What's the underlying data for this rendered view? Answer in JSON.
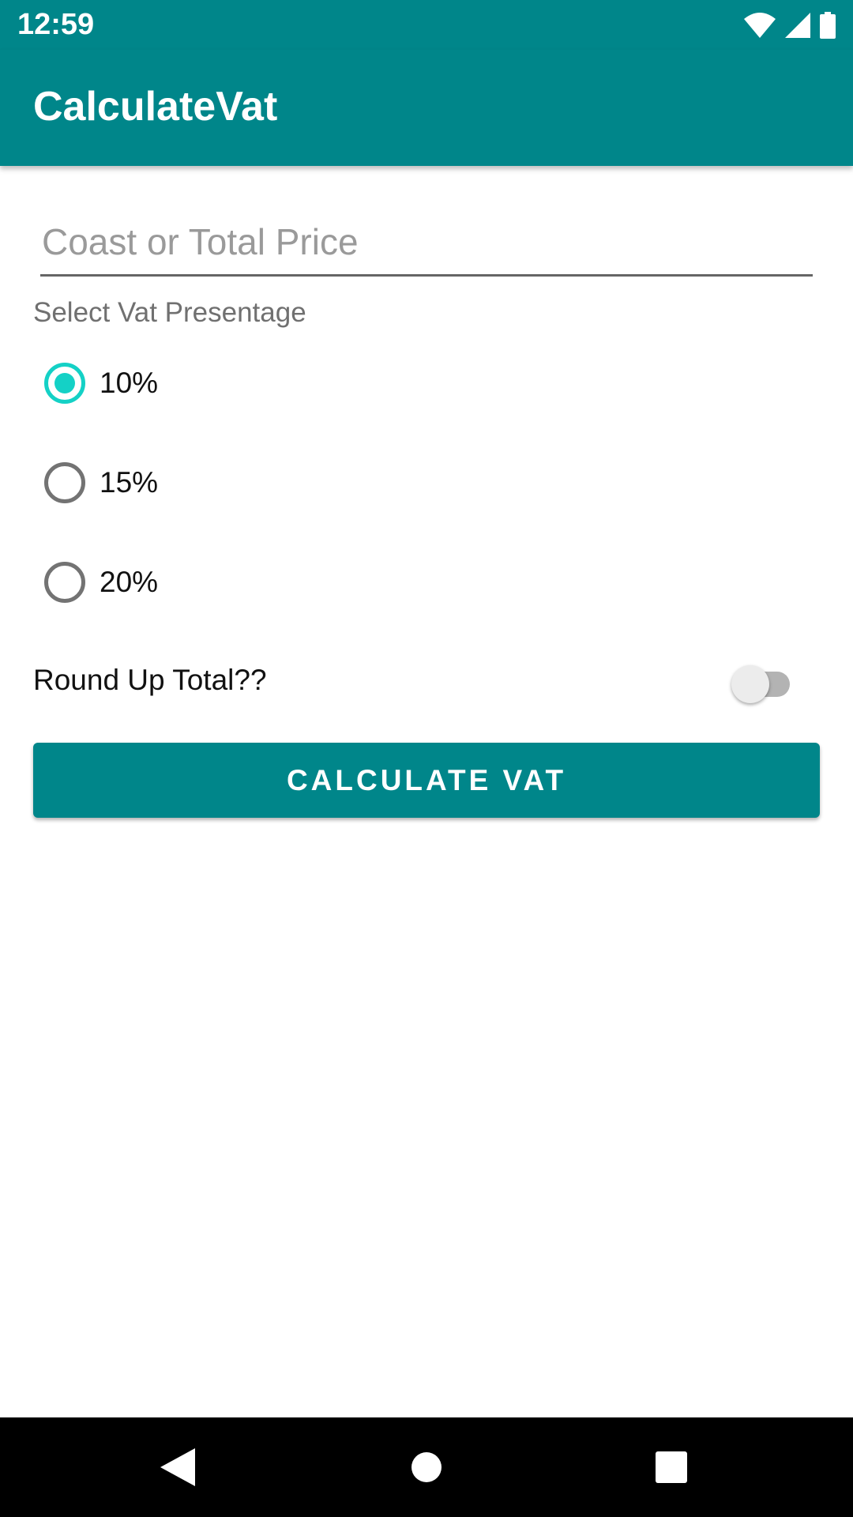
{
  "status_bar": {
    "time": "12:59",
    "icons": [
      "wifi-icon",
      "cell-signal-icon",
      "battery-icon"
    ]
  },
  "app_bar": {
    "title": "CalculateVat",
    "color": "#00868a"
  },
  "form": {
    "price_placeholder": "Coast or Total Price",
    "price_value": "",
    "vat_label": "Select Vat Presentage",
    "vat_options": [
      {
        "label": "10%",
        "selected": true
      },
      {
        "label": "15%",
        "selected": false
      },
      {
        "label": "20%",
        "selected": false
      }
    ],
    "round_up_label": "Round Up Total??",
    "round_up_enabled": false,
    "calculate_button": "CALCULATE VAT"
  },
  "colors": {
    "primary": "#00868a",
    "accent": "#14d1c6"
  },
  "nav_bar": {
    "icons": [
      "back-icon",
      "home-icon",
      "recents-icon"
    ]
  }
}
